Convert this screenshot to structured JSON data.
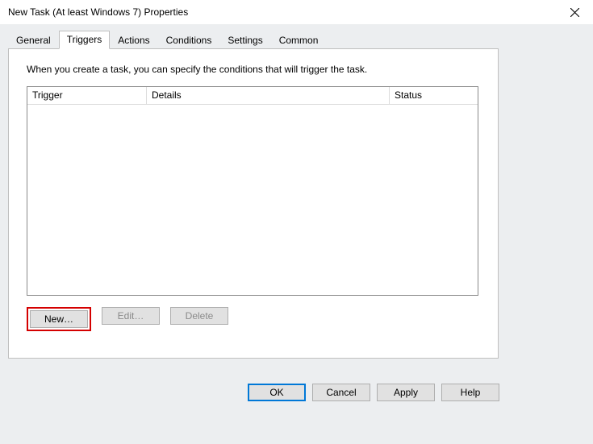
{
  "window": {
    "title": "New Task (At least Windows 7) Properties"
  },
  "tabs": {
    "general": "General",
    "triggers": "Triggers",
    "actions": "Actions",
    "conditions": "Conditions",
    "settings": "Settings",
    "common": "Common"
  },
  "triggers_panel": {
    "hint": "When you create a task, you can specify the conditions that will trigger the task.",
    "columns": {
      "trigger": "Trigger",
      "details": "Details",
      "status": "Status"
    },
    "buttons": {
      "new": "New…",
      "edit": "Edit…",
      "delete": "Delete"
    }
  },
  "dialog_buttons": {
    "ok": "OK",
    "cancel": "Cancel",
    "apply": "Apply",
    "help": "Help"
  }
}
